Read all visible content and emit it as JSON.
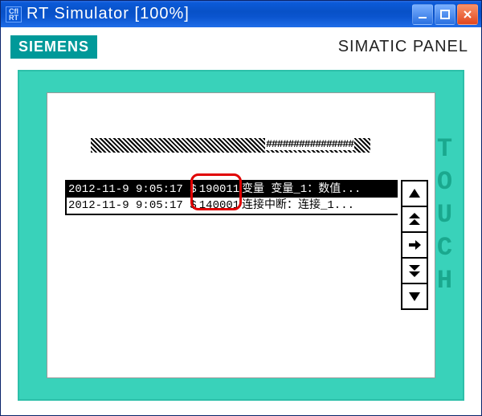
{
  "window": {
    "icon_label": "Cfl\nRT",
    "title": "RT Simulator [100%]"
  },
  "header": {
    "logo": "SIEMENS",
    "panel_label": "SIMATIC PANEL",
    "touch_label": "TOUCH"
  },
  "screen": {
    "hash_text": "################",
    "alarms": [
      {
        "timestamp": "2012-11-9 9:05:17 $",
        "code": "190011",
        "message": "变量 变量_1：数值...",
        "selected": true
      },
      {
        "timestamp": "2012-11-9 9:05:17 $",
        "code": "140001",
        "message": "连接中断：连接_1...",
        "selected": false
      }
    ]
  },
  "nav": {
    "up": "up-icon",
    "page_up": "page-up-icon",
    "ack": "ack-icon",
    "page_down": "page-down-icon",
    "down": "down-icon"
  }
}
